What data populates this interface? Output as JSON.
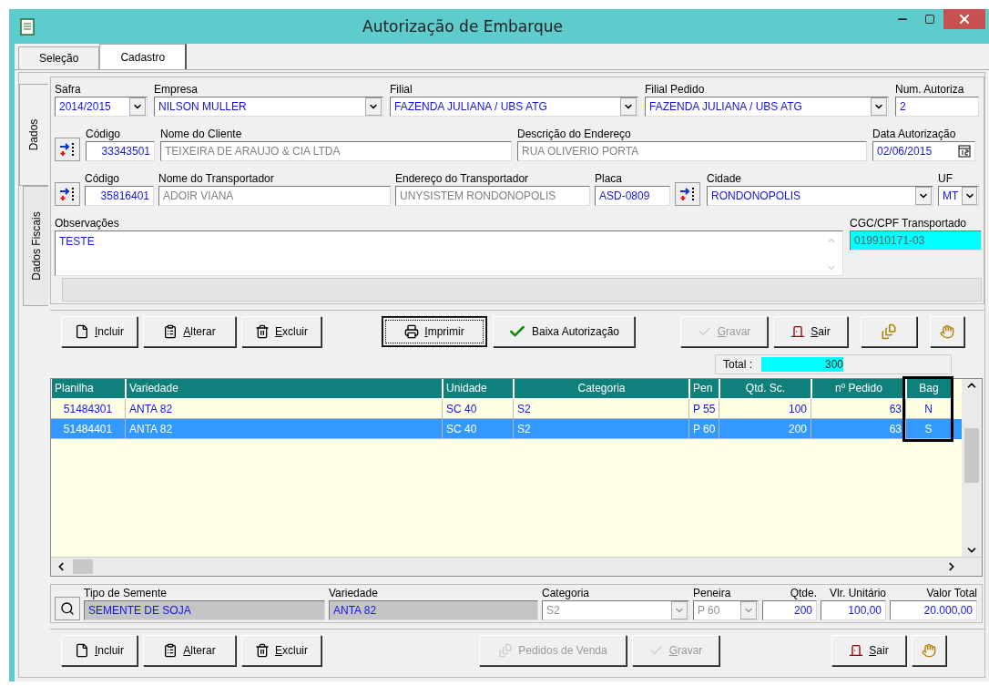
{
  "window": {
    "title": "Autorização de Embarque"
  },
  "tabs": [
    {
      "label": "Seleção",
      "selected": false
    },
    {
      "label": "Cadastro",
      "selected": true
    }
  ],
  "side_tabs": [
    {
      "label": "Dados",
      "selected": true
    },
    {
      "label": "Dados Fiscais",
      "selected": false
    }
  ],
  "form_rows": [
    [
      {
        "kind": "combo",
        "label": "Safra",
        "value": "2014/2015",
        "readonly": false
      },
      {
        "kind": "combo",
        "label": "Empresa",
        "value": "NILSON MULLER",
        "readonly": false
      },
      {
        "kind": "combo",
        "label": "Filial",
        "value": "FAZENDA JULIANA / UBS ATG",
        "readonly": false
      },
      {
        "kind": "combo",
        "label": "Filial Pedido",
        "value": "FAZENDA JULIANA / UBS ATG",
        "readonly": false
      },
      {
        "kind": "text",
        "label": "Num. Autoriza",
        "value": "2",
        "readonly": false
      }
    ],
    [
      {
        "kind": "lookup"
      },
      {
        "kind": "number",
        "label": "Código",
        "value": "33343501",
        "readonly": false
      },
      {
        "kind": "text",
        "label": "Nome do Cliente",
        "value": "TEIXEIRA DE ARAUJO & CIA LTDA",
        "readonly": true
      },
      {
        "kind": "text",
        "label": "Descrição do Endereço",
        "value": "RUA OLIVERIO PORTA",
        "readonly": true
      },
      {
        "kind": "date",
        "label": "Data Autorização",
        "value": "02/06/2015",
        "readonly": false
      }
    ],
    [
      {
        "kind": "lookup"
      },
      {
        "kind": "number",
        "label": "Código",
        "value": "35816401",
        "readonly": false
      },
      {
        "kind": "text",
        "label": "Nome do Transportador",
        "value": "ADOIR VIANA",
        "readonly": true
      },
      {
        "kind": "text",
        "label": "Endereço do Transportador",
        "value": "UNYSISTEM RONDONOPOLIS",
        "readonly": true
      },
      {
        "kind": "text",
        "label": "Placa",
        "value": "ASD-0809",
        "readonly": false
      },
      {
        "kind": "lookup"
      },
      {
        "kind": "combo",
        "label": "Cidade",
        "value": "RONDONOPOLIS",
        "readonly": false
      },
      {
        "kind": "combo",
        "label": "UF",
        "value": "MT",
        "readonly": false
      }
    ],
    [
      {
        "kind": "memo",
        "label": "Observações",
        "value": "TESTE",
        "readonly": false,
        "highlighted": false
      },
      {
        "kind": "text",
        "label": "CGC/CPF Transportado",
        "value": "019910171-03",
        "highlighted": true
      }
    ]
  ],
  "toolbar": [
    {
      "label": "Incluir",
      "mnemonic": true,
      "disabled": false,
      "focused": false
    },
    {
      "label": "Alterar",
      "mnemonic": true,
      "disabled": false,
      "focused": false
    },
    {
      "label": "Excluir",
      "mnemonic": true,
      "disabled": false,
      "focused": false
    },
    {
      "label": "Imprimir",
      "mnemonic": true,
      "disabled": false,
      "focused": true
    },
    {
      "label": "Baixa Autorização",
      "mnemonic": false,
      "disabled": false,
      "focused": false
    },
    {
      "label": "Gravar",
      "mnemonic": true,
      "disabled": true,
      "focused": false
    },
    {
      "label": "Sair",
      "mnemonic": true,
      "disabled": false,
      "focused": false
    },
    {
      "disabled": false,
      "focused": false
    },
    {
      "disabled": false,
      "focused": false
    }
  ],
  "total": {
    "label": "Total :",
    "value": "300"
  },
  "grid": {
    "columns": [
      {
        "label": "Planilha",
        "outlined": false
      },
      {
        "label": "Variedade",
        "outlined": false
      },
      {
        "label": "Unidade",
        "outlined": false
      },
      {
        "label": "Categoria",
        "outlined": false
      },
      {
        "label": "Pen",
        "outlined": false
      },
      {
        "label": "Qtd. Sc.",
        "outlined": false
      },
      {
        "label": "nº Pedido",
        "outlined": false
      },
      {
        "label": "Bag",
        "outlined": true
      }
    ],
    "rows": [
      {
        "selected": false,
        "cells": [
          "51484301",
          "ANTA 82",
          "SC 40",
          "S2",
          "P 55",
          "100",
          "63",
          "N"
        ]
      },
      {
        "selected": true,
        "cells": [
          "51484401",
          "ANTA 82",
          "SC 40",
          "S2",
          "P 60",
          "200",
          "63",
          "S"
        ]
      }
    ]
  },
  "item_fields": [
    {
      "kind": "search"
    },
    {
      "kind": "text",
      "label": "Tipo de Semente",
      "value": "SEMENTE DE SOJA",
      "shaded": true,
      "disabled": false
    },
    {
      "kind": "text",
      "label": "Variedade",
      "value": "ANTA 82",
      "shaded": true,
      "disabled": false
    },
    {
      "kind": "combo",
      "label": "Categoria",
      "value": "S2",
      "shaded": false,
      "disabled": true
    },
    {
      "kind": "combo",
      "label": "Peneira",
      "value": "P 60",
      "shaded": false,
      "disabled": true
    },
    {
      "kind": "number",
      "label": "Qtde.",
      "value": "200",
      "shaded": false,
      "disabled": false
    },
    {
      "kind": "number",
      "label": "Vlr. Unitário",
      "value": "100,00",
      "shaded": false,
      "disabled": false
    },
    {
      "kind": "number",
      "label": "Valor Total",
      "value": "20.000,00",
      "shaded": false,
      "disabled": false
    }
  ],
  "bottom_toolbar": [
    {
      "label": "Incluir",
      "mnemonic": true,
      "disabled": false,
      "focused": false
    },
    {
      "label": "Alterar",
      "mnemonic": true,
      "disabled": false,
      "focused": false
    },
    {
      "label": "Excluir",
      "mnemonic": true,
      "disabled": false,
      "focused": false
    },
    {
      "label": "Pedidos de Venda",
      "mnemonic": false,
      "disabled": true,
      "focused": false
    },
    {
      "label": "Gravar",
      "mnemonic": true,
      "disabled": true,
      "focused": false
    },
    {
      "label": "Sair",
      "mnemonic": true,
      "disabled": false,
      "focused": false
    },
    {
      "disabled": false,
      "focused": false
    }
  ]
}
